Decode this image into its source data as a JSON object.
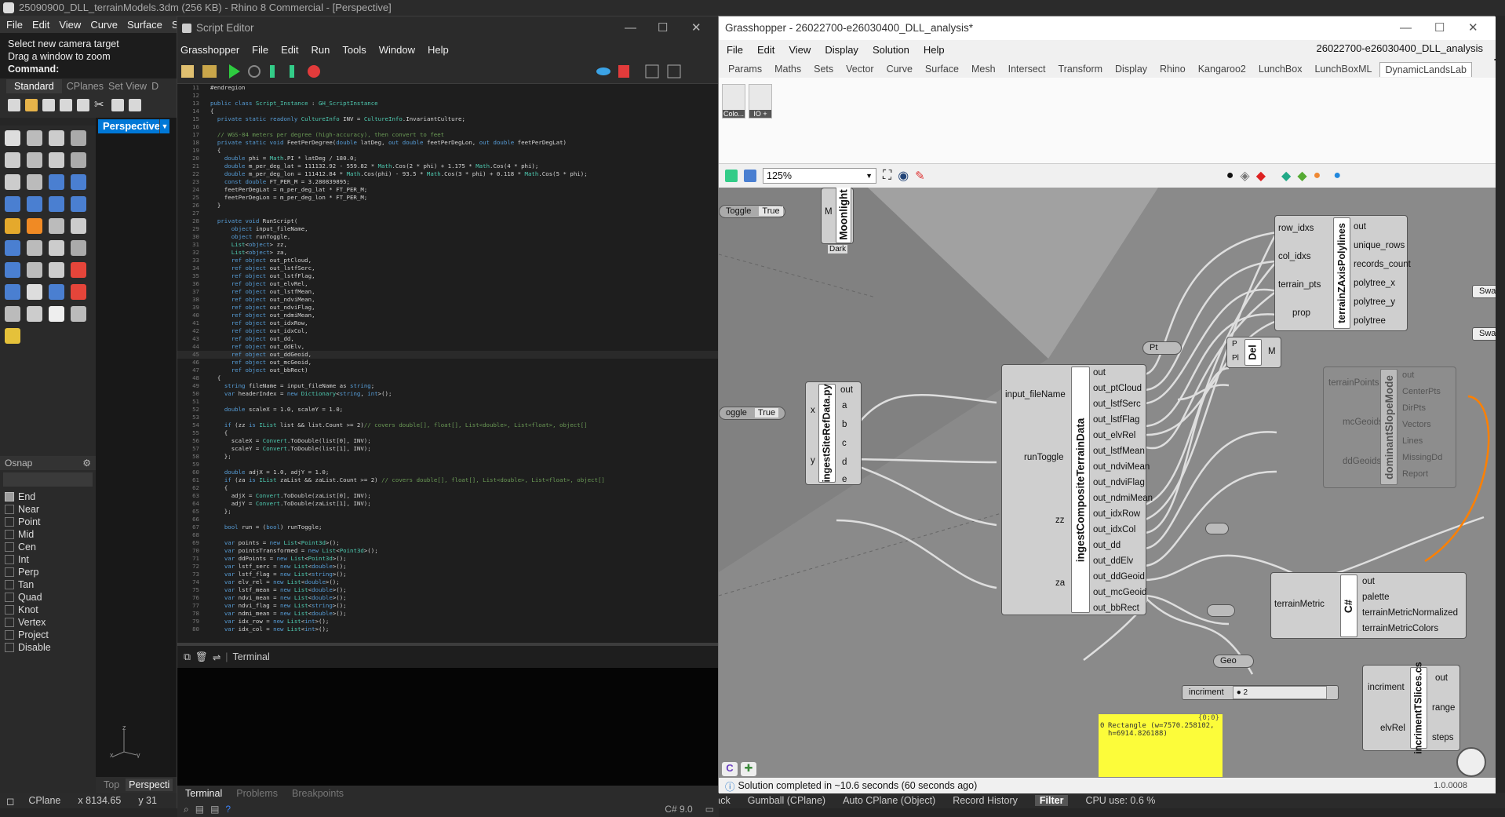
{
  "rhino": {
    "title": "25090900_DLL_terrainModels.3dm (256 KB) - Rhino 8 Commercial - [Perspective]",
    "menu": [
      "File",
      "Edit",
      "View",
      "Curve",
      "Surface",
      "Sc"
    ],
    "command_history": [
      "Select new camera target",
      "Drag a window to zoom"
    ],
    "command_label": "Command:",
    "tabs": [
      "Standard",
      "CPlanes",
      "Set View",
      "D"
    ],
    "viewport_name": "Perspective",
    "viewport_bottom_tabs": [
      "Top",
      "Perspecti"
    ],
    "axes": {
      "z": "z",
      "x": "x",
      "y": "y"
    },
    "osnap_title": "Osnap",
    "osnaps": [
      {
        "label": "End",
        "checked": true
      },
      {
        "label": "Near",
        "checked": false
      },
      {
        "label": "Point",
        "checked": false
      },
      {
        "label": "Mid",
        "checked": false
      },
      {
        "label": "Cen",
        "checked": false
      },
      {
        "label": "Int",
        "checked": false
      },
      {
        "label": "Perp",
        "checked": false
      },
      {
        "label": "Tan",
        "checked": false
      },
      {
        "label": "Quad",
        "checked": false
      },
      {
        "label": "Knot",
        "checked": false
      },
      {
        "label": "Vertex",
        "checked": false
      },
      {
        "label": "Project",
        "checked": false
      },
      {
        "label": "Disable",
        "checked": false
      }
    ],
    "status": {
      "cplane": "CPlane",
      "x": "x 8134.65",
      "y": "y 31",
      "track": "Track",
      "gumball": "Gumball (CPlane)",
      "autocplane": "Auto CPlane (Object)",
      "record": "Record History",
      "filter": "Filter",
      "cpu": "CPU use: 0.6 %"
    }
  },
  "script_editor": {
    "title": "Script Editor",
    "menu": [
      "Grasshopper",
      "File",
      "Edit",
      "Run",
      "Tools",
      "Window",
      "Help"
    ],
    "terminal_label": "Terminal",
    "bottom_tabs": [
      "Terminal",
      "Problems",
      "Breakpoints"
    ],
    "language": "C# 9.0",
    "code_lines": [
      [
        "11",
        "#endregion"
      ],
      [
        "12",
        ""
      ],
      [
        "13",
        "public class Script_Instance : GH_ScriptInstance"
      ],
      [
        "14",
        "{"
      ],
      [
        "15",
        "  private static readonly CultureInfo INV = CultureInfo.InvariantCulture;"
      ],
      [
        "16",
        ""
      ],
      [
        "17",
        "  // WGS-84 meters per degree (high-accuracy), then convert to feet"
      ],
      [
        "18",
        "  private static void FeetPerDegree(double latDeg, out double feetPerDegLon, out double feetPerDegLat)"
      ],
      [
        "19",
        "  {"
      ],
      [
        "20",
        "    double phi = Math.PI * latDeg / 180.0;"
      ],
      [
        "21",
        "    double m_per_deg_lat = 111132.92 - 559.82 * Math.Cos(2 * phi) + 1.175 * Math.Cos(4 * phi);"
      ],
      [
        "22",
        "    double m_per_deg_lon = 111412.84 * Math.Cos(phi) - 93.5 * Math.Cos(3 * phi) + 0.118 * Math.Cos(5 * phi);"
      ],
      [
        "23",
        "    const double FT_PER_M = 3.280839895;"
      ],
      [
        "24",
        "    feetPerDegLat = m_per_deg_lat * FT_PER_M;"
      ],
      [
        "25",
        "    feetPerDegLon = m_per_deg_lon * FT_PER_M;"
      ],
      [
        "26",
        "  }"
      ],
      [
        "27",
        ""
      ],
      [
        "28",
        "  private void RunScript("
      ],
      [
        "29",
        "      object input_fileName,"
      ],
      [
        "30",
        "      object runToggle,"
      ],
      [
        "31",
        "      List<object> zz,"
      ],
      [
        "32",
        "      List<object> za,"
      ],
      [
        "33",
        "      ref object out_ptCloud,"
      ],
      [
        "34",
        "      ref object out_lstfSerc,"
      ],
      [
        "35",
        "      ref object out_lstfFlag,"
      ],
      [
        "36",
        "      ref object out_elvRel,"
      ],
      [
        "37",
        "      ref object out_lstfMean,"
      ],
      [
        "38",
        "      ref object out_ndviMean,"
      ],
      [
        "39",
        "      ref object out_ndviFlag,"
      ],
      [
        "40",
        "      ref object out_ndmiMean,"
      ],
      [
        "41",
        "      ref object out_idxRow,"
      ],
      [
        "42",
        "      ref object out_idxCol,"
      ],
      [
        "43",
        "      ref object out_dd,"
      ],
      [
        "44",
        "      ref object out_ddElv,"
      ],
      [
        "45",
        "      ref object out_ddGeoid,"
      ],
      [
        "46",
        "      ref object out_mcGeoid,"
      ],
      [
        "47",
        "      ref object out_bbRect)"
      ],
      [
        "48",
        "  {"
      ],
      [
        "49",
        "    string fileName = input_fileName as string;"
      ],
      [
        "50",
        "    var headerIndex = new Dictionary<string, int>();"
      ],
      [
        "51",
        ""
      ],
      [
        "52",
        "    double scaleX = 1.0, scaleY = 1.0;"
      ],
      [
        "53",
        ""
      ],
      [
        "54",
        "    if (zz is IList list && list.Count >= 2)// covers double[], float[], List<double>, List<float>, object[]"
      ],
      [
        "55",
        "    {"
      ],
      [
        "56",
        "      scaleX = Convert.ToDouble(list[0], INV);"
      ],
      [
        "57",
        "      scaleY = Convert.ToDouble(list[1], INV);"
      ],
      [
        "58",
        "    };"
      ],
      [
        "59",
        ""
      ],
      [
        "60",
        "    double adjX = 1.0, adjY = 1.0;"
      ],
      [
        "61",
        "    if (za is IList zaList && zaList.Count >= 2) // covers double[], float[], List<double>, List<float>, object[]"
      ],
      [
        "62",
        "    {"
      ],
      [
        "63",
        "      adjX = Convert.ToDouble(zaList[0], INV);"
      ],
      [
        "64",
        "      adjY = Convert.ToDouble(zaList[1], INV);"
      ],
      [
        "65",
        "    };"
      ],
      [
        "66",
        ""
      ],
      [
        "67",
        "    bool run = (bool) runToggle;"
      ],
      [
        "68",
        ""
      ],
      [
        "69",
        "    var points = new List<Point3d>();"
      ],
      [
        "70",
        "    var pointsTransformed = new List<Point3d>();"
      ],
      [
        "71",
        "    var ddPoints = new List<Point3d>();"
      ],
      [
        "72",
        "    var lstf_serc = new List<double>();"
      ],
      [
        "73",
        "    var lstf_flag = new List<string>();"
      ],
      [
        "74",
        "    var elv_rel = new List<double>();"
      ],
      [
        "75",
        "    var lstf_mean = new List<double>();"
      ],
      [
        "76",
        "    var ndvi_mean = new List<double>();"
      ],
      [
        "77",
        "    var ndvi_flag = new List<string>();"
      ],
      [
        "78",
        "    var ndmi_mean = new List<double>();"
      ],
      [
        "79",
        "    var idx_row = new List<int>();"
      ],
      [
        "80",
        "    var idx_col = new List<int>();"
      ]
    ]
  },
  "grasshopper": {
    "title": "Grasshopper - 26022700-e26030400_DLL_analysis*",
    "menu": [
      "File",
      "Edit",
      "View",
      "Display",
      "Solution",
      "Help"
    ],
    "document_name": "26022700-e26030400_DLL_analysis",
    "tabs": [
      "Params",
      "Maths",
      "Sets",
      "Vector",
      "Curve",
      "Surface",
      "Mesh",
      "Intersect",
      "Transform",
      "Display",
      "Rhino",
      "Kangaroo2",
      "LunchBox",
      "LunchBoxML",
      "DynamicLandsLab"
    ],
    "ribbon_items": [
      "Colo...",
      "IO +"
    ],
    "zoom": "125%",
    "solution_status": "Solution completed in ~10.6 seconds (60 seconds ago)",
    "version": "1.0.0008",
    "nodes": {
      "toggle1": {
        "label": "Toggle",
        "value": "True"
      },
      "toggle2": {
        "label": "oggle",
        "value": "True"
      },
      "moonlight": {
        "name": "Moonlight",
        "input": "M",
        "footer": "Dark"
      },
      "ingest_site": {
        "name": "ingestSiteRefData.py",
        "inputs": [
          "x",
          "y"
        ],
        "outputs": [
          "out",
          "a",
          "b",
          "c",
          "d",
          "e"
        ]
      },
      "ingest_comp": {
        "name": "ingestCompositeTerrainData",
        "inputs": [
          "input_fileName",
          "runToggle",
          "zz",
          "za"
        ],
        "outputs": [
          "out",
          "out_ptCloud",
          "out_lstfSerc",
          "out_lstfFlag",
          "out_elvRel",
          "out_lstfMean",
          "out_ndviMean",
          "out_ndviFlag",
          "out_ndmiMean",
          "out_idxRow",
          "out_idxCol",
          "out_dd",
          "out_ddElv",
          "out_ddGeoid",
          "out_mcGeoid",
          "out_bbRect"
        ]
      },
      "terrain_z": {
        "name": "terrainZAxisPolylines",
        "inputs": [
          "row_idxs",
          "col_idxs",
          "terrain_pts",
          "prop"
        ],
        "outputs": [
          "out",
          "unique_rows",
          "records_count",
          "polytree_x",
          "polytree_y",
          "polytree"
        ]
      },
      "pt": {
        "label": "Pt"
      },
      "del": {
        "name": "Del",
        "inputs": [
          "P",
          "Pl"
        ],
        "output": "M"
      },
      "dominant": {
        "name": "dominantSlopeMode",
        "inputs": [
          "terrainPoints",
          "mcGeoids",
          "ddGeoids"
        ],
        "outputs": [
          "out",
          "CenterPts",
          "DirPts",
          "Vectors",
          "Lines",
          "MissingDd",
          "Report"
        ]
      },
      "csharp": {
        "name": "C#",
        "input": "terrainMetric",
        "outputs": [
          "out",
          "palette",
          "terrainMetricNormalized",
          "terrainMetricColors"
        ]
      },
      "geo": {
        "label": "Geo"
      },
      "incriment": {
        "label": "incriment",
        "value": "2"
      },
      "incriment_slices": {
        "name": "incrimentTSlices.cs",
        "inputs": [
          "incriment",
          "elvRel"
        ],
        "outputs": [
          "out",
          "range",
          "steps"
        ]
      },
      "panel": {
        "header": "{0;0}",
        "index": "0",
        "text": "Rectangle (w=7570.258102, h=6914.826188)"
      },
      "swatch": [
        "Swatc",
        "Swatc"
      ]
    }
  }
}
